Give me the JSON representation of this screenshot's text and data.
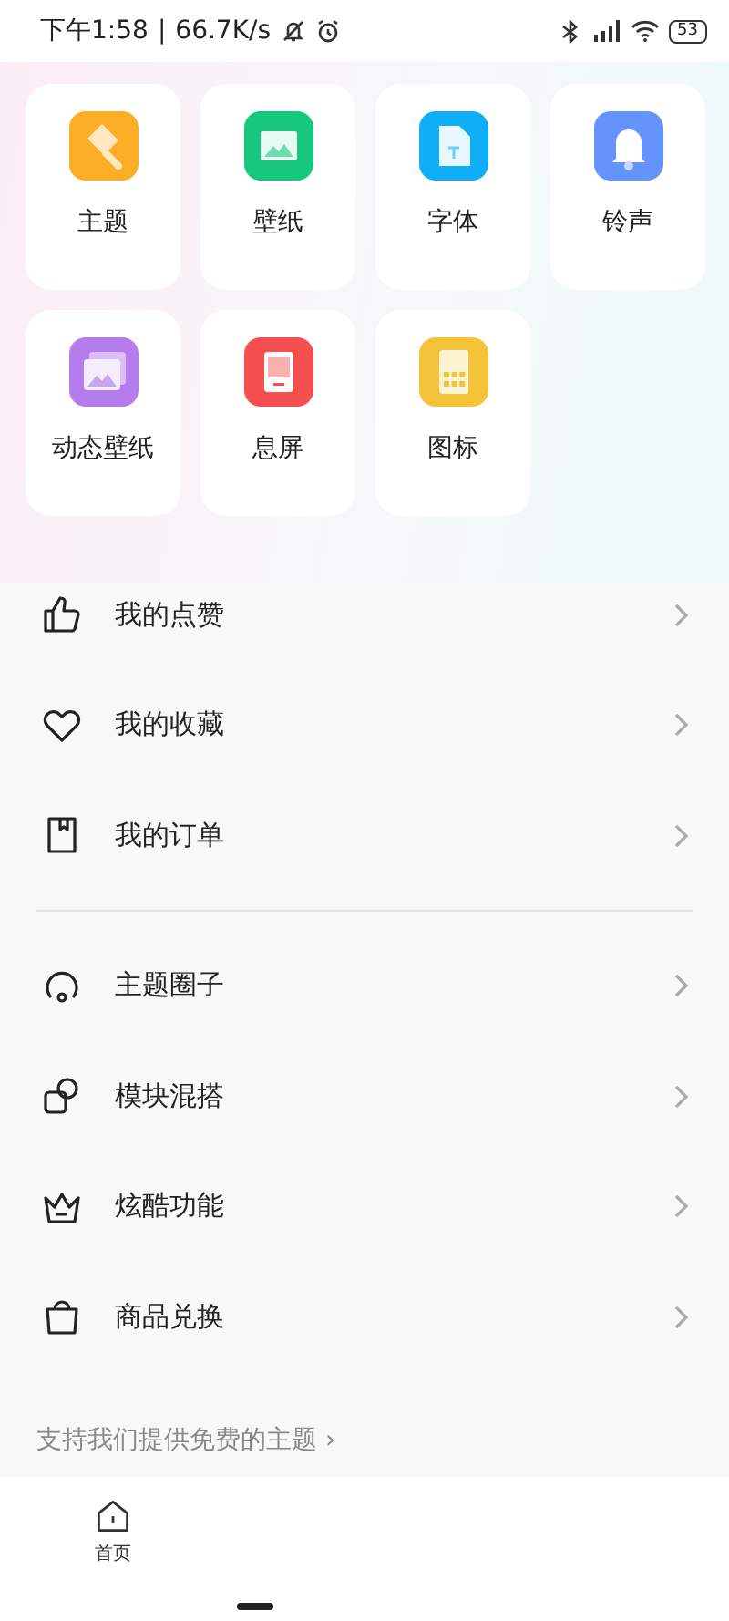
{
  "status_bar": {
    "time": "下午1:58",
    "separator": "|",
    "speed": "66.7K/s",
    "battery": "53"
  },
  "categories": [
    {
      "label": "主题",
      "kind": "theme",
      "color": "#fbad26"
    },
    {
      "label": "壁纸",
      "kind": "wallpaper",
      "color": "#18c77e"
    },
    {
      "label": "字体",
      "kind": "font",
      "color": "#10aef5"
    },
    {
      "label": "铃声",
      "kind": "ringtone",
      "color": "#6494fb"
    },
    {
      "label": "动态壁纸",
      "kind": "live",
      "color": "#b57ced"
    },
    {
      "label": "息屏",
      "kind": "aod",
      "color": "#f5504f"
    },
    {
      "label": "图标",
      "kind": "icons",
      "color": "#f3c33a"
    }
  ],
  "menu_groups": [
    [
      {
        "label": "我的点赞",
        "kind": "like"
      },
      {
        "label": "我的收藏",
        "kind": "heart"
      },
      {
        "label": "我的订单",
        "kind": "order"
      }
    ],
    [
      {
        "label": "主题圈子",
        "kind": "circle"
      },
      {
        "label": "模块混搭",
        "kind": "mix"
      },
      {
        "label": "炫酷功能",
        "kind": "crown"
      },
      {
        "label": "商品兑换",
        "kind": "bag"
      }
    ]
  ],
  "footer_link": "支持我们提供免费的主题 ›",
  "bottom_nav": [
    {
      "label": "首页",
      "selected": false
    }
  ]
}
